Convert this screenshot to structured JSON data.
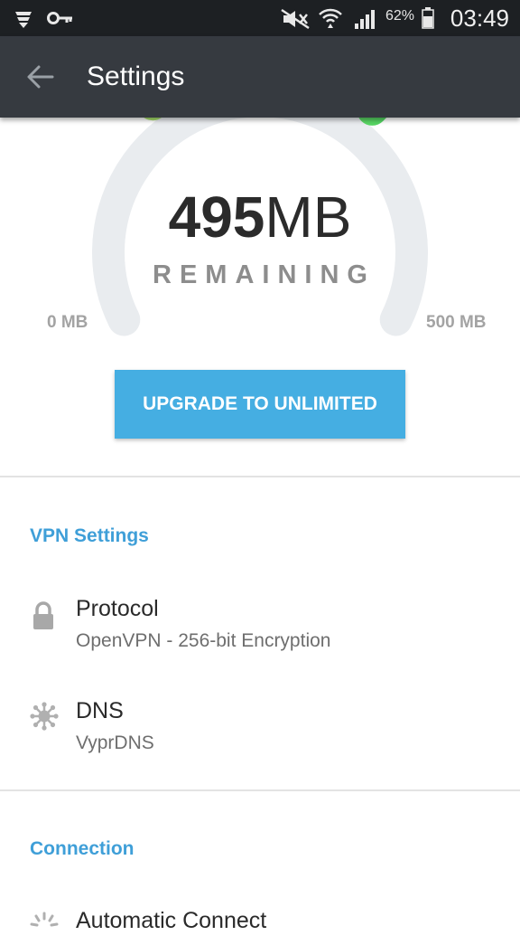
{
  "status_bar": {
    "battery": "62%",
    "time": "03:49",
    "icons": [
      "vyprvpn-icon",
      "key-icon",
      "mute-icon",
      "wifi-icon",
      "signal-icon",
      "battery-icon"
    ]
  },
  "app_bar": {
    "title": "Settings",
    "back_icon": "arrow-left-icon"
  },
  "usage": {
    "amount_value": "495",
    "amount_unit": "MB",
    "remaining_label": "REMAINING",
    "min_label": "0 MB",
    "max_label": "500 MB",
    "fraction_remaining": 0.99,
    "gauge_colors": [
      "#b7e36d",
      "#47d462"
    ]
  },
  "upgrade_button": "UPGRADE TO UNLIMITED",
  "vpn_settings": {
    "header": "VPN Settings",
    "items": [
      {
        "title": "Protocol",
        "subtitle": "OpenVPN - 256-bit Encryption",
        "icon": "lock-icon"
      },
      {
        "title": "DNS",
        "subtitle": "VyprDNS",
        "icon": "dns-icon"
      }
    ]
  },
  "connection": {
    "header": "Connection",
    "items": [
      {
        "title": "Automatic Connect",
        "icon": "auto-connect-icon"
      }
    ]
  },
  "colors": {
    "accent": "#45aee2",
    "section_header": "#3f9fd8",
    "app_bar": "#363a40"
  }
}
